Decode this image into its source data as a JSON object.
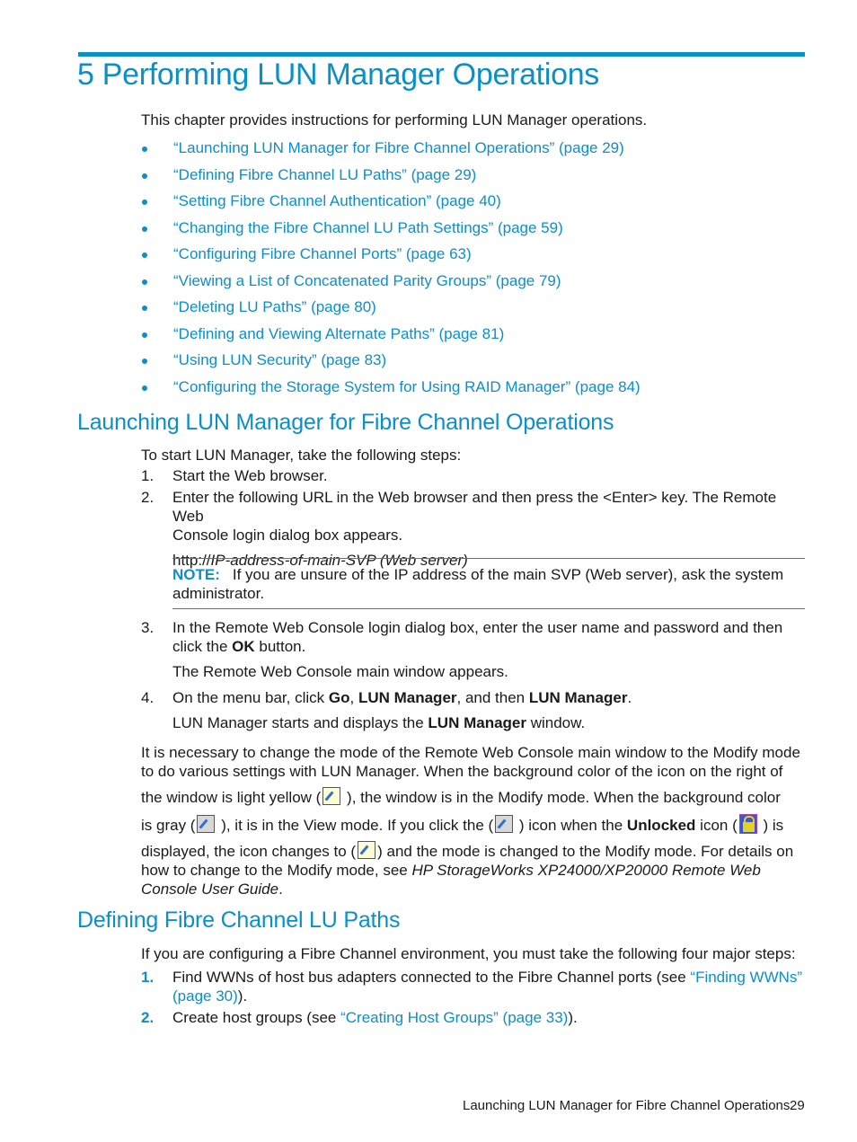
{
  "chapter": {
    "title": "5 Performing LUN Manager Operations",
    "intro": "This chapter provides instructions for performing LUN Manager operations.",
    "toc": [
      {
        "label": "“Launching LUN Manager for Fibre Channel Operations” (page 29)"
      },
      {
        "label": "“Defining Fibre Channel LU Paths” (page 29)"
      },
      {
        "label": "“Setting Fibre Channel Authentication” (page 40)"
      },
      {
        "label": "“Changing the Fibre Channel LU Path Settings” (page 59)"
      },
      {
        "label": "“Configuring Fibre Channel Ports” (page 63)"
      },
      {
        "label": "“Viewing a List of Concatenated Parity Groups” (page 79)"
      },
      {
        "label": "“Deleting LU Paths” (page 80)"
      },
      {
        "label": "“Defining and Viewing Alternate Paths” (page 81)"
      },
      {
        "label": "“Using LUN Security” (page 83)"
      },
      {
        "label": "“Configuring the Storage System for Using RAID Manager” (page 84)"
      }
    ]
  },
  "section1": {
    "heading": "Launching LUN Manager for Fibre Channel Operations",
    "intro": "To start LUN Manager, take the following steps:",
    "steps": [
      {
        "num": "1.",
        "text": "Start the Web browser."
      },
      {
        "num": "2.",
        "text_a": "Enter the following URL in the Web browser and then press the <Enter> key. The Remote Web",
        "text_b": "Console login dialog box appears.",
        "url_prefix": "http://",
        "url_italic": "IP-address-of-main-SVP (Web server)"
      },
      {
        "num": "3.",
        "text_a": "In the Remote Web Console login dialog box, enter the user name and password and then",
        "text_b_pre": "click the ",
        "text_b_bold": "OK",
        "text_b_post": " button.",
        "result": "The Remote Web Console main window appears."
      },
      {
        "num": "4.",
        "pre": "On the menu bar, click ",
        "b1": "Go",
        "sep1": ", ",
        "b2": "LUN Manager",
        "sep2": ", and then ",
        "b3": "LUN Manager",
        "post": ".",
        "result_pre": "LUN Manager starts and displays the ",
        "result_bold": "LUN Manager",
        "result_post": " window."
      }
    ],
    "note": {
      "label": "NOTE:",
      "text_a": "If you are unsure of the IP address of the main SVP (Web server), ask the system",
      "text_b": "administrator."
    },
    "para": {
      "l1": "It is necessary to change the mode of the Remote Web Console main window to the Modify mode",
      "l2": "to do various settings with LUN Manager. When the background color of the icon on the right of",
      "l3a": "the window is light yellow (",
      "l3b": " ), the window is in the Modify mode. When the background color",
      "l4a": "is gray (",
      "l4b": " ), it is in the View mode. If you click the (",
      "l4c": " ) icon when the ",
      "l4bold": "Unlocked",
      "l4d": " icon (",
      "l4e": " ) is",
      "l5a": "displayed, the icon changes to (",
      "l5b": ") and the mode is changed to the Modify mode. For details on",
      "l6a": "how to change to the Modify mode, see ",
      "l6i": "HP StorageWorks XP24000/XP20000 Remote Web",
      "l7i": "Console User Guide",
      "l7b": "."
    }
  },
  "section2": {
    "heading": "Defining Fibre Channel LU Paths",
    "intro": "If you are configuring a Fibre Channel environment, you must take the following four major steps:",
    "steps": [
      {
        "num": "1.",
        "pre": "Find WWNs of host bus adapters connected to the Fibre Channel ports (see ",
        "link_a": "“Finding WWNs”",
        "link_b": "(page 30)",
        "post": ")."
      },
      {
        "num": "2.",
        "pre": "Create host groups (see ",
        "link": "“Creating Host Groups” (page 33)",
        "post": ")."
      }
    ]
  },
  "footer": {
    "section_title": "Launching LUN Manager for Fibre Channel Operations",
    "page_number": "29"
  },
  "colors": {
    "accent": "#0a8fc9",
    "text": "#1a1a1a"
  }
}
